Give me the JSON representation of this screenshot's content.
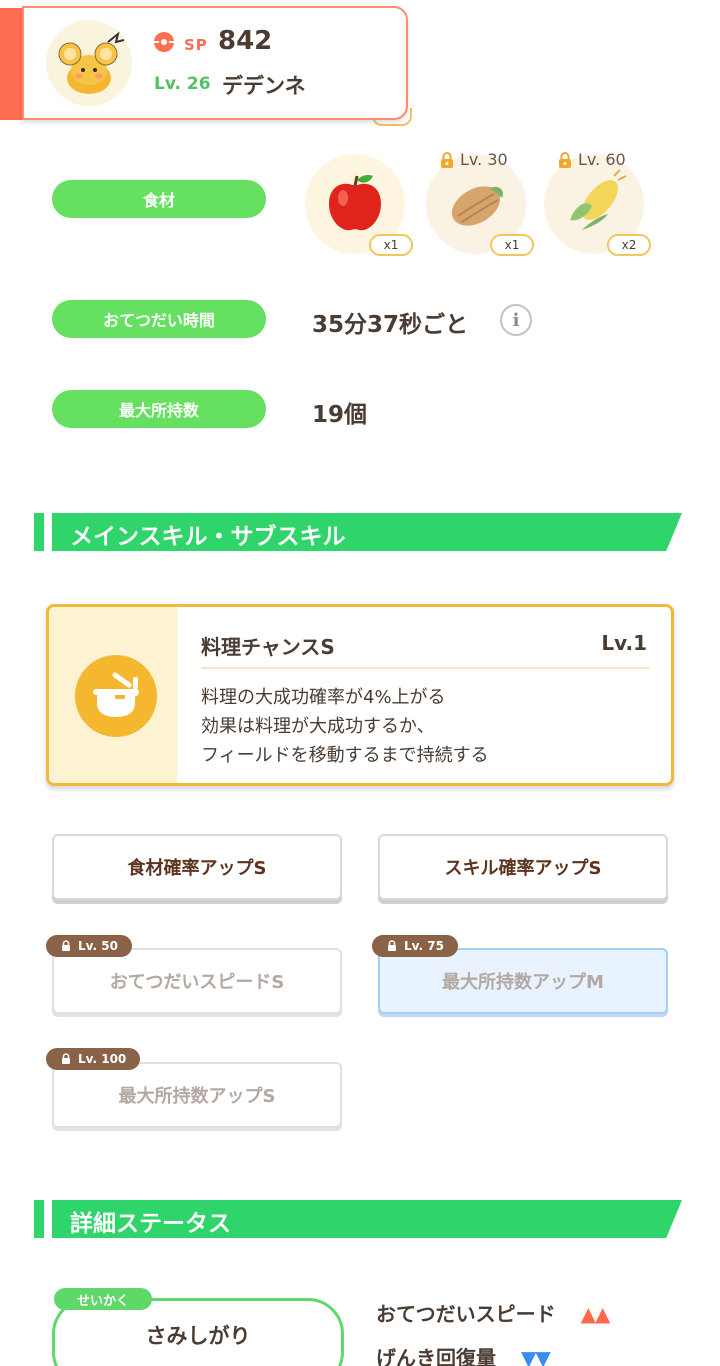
{
  "header": {
    "sp_label": "SP",
    "sp_value": "842",
    "level": "Lv. 26",
    "pokemon_name": "デデンネ",
    "accent_color": "#ff6e50"
  },
  "rows": {
    "ingredients_label": "食材",
    "helping_time_label": "おてつだい時間",
    "helping_time_value": "35分37秒ごと",
    "max_carry_label": "最大所持数",
    "max_carry_value": "19個"
  },
  "ingredients": [
    {
      "icon": "apple-icon",
      "qty": "x1",
      "lock": ""
    },
    {
      "icon": "cacao-icon",
      "qty": "x1",
      "lock": "Lv. 30"
    },
    {
      "icon": "corn-icon",
      "qty": "x2",
      "lock": "Lv. 60"
    }
  ],
  "main_skill_section": {
    "title": "メインスキル・サブスキル"
  },
  "main_skill": {
    "name": "料理チャンスS",
    "level": "Lv.1",
    "desc_line1": "料理の大成功確率が4%上がる",
    "desc_line2": "効果は料理が大成功するか、",
    "desc_line3": "フィールドを移動するまで持続する"
  },
  "sub_skills": [
    {
      "label": "食材確率アップS",
      "lock": ""
    },
    {
      "label": "スキル確率アップS",
      "lock": ""
    },
    {
      "label": "おてつだいスピードS",
      "lock": "Lv. 50"
    },
    {
      "label": "最大所持数アップM",
      "lock": "Lv. 75"
    },
    {
      "label": "最大所持数アップS",
      "lock": "Lv. 100"
    }
  ],
  "detail_section": {
    "title": "詳細ステータス"
  },
  "nature": {
    "tag": "せいかく",
    "name": "さみしがり",
    "up_label": "おてつだいスピード",
    "up_arrows": "▲▲",
    "down_label": "げんき回復量",
    "down_arrows": "▼▼"
  }
}
